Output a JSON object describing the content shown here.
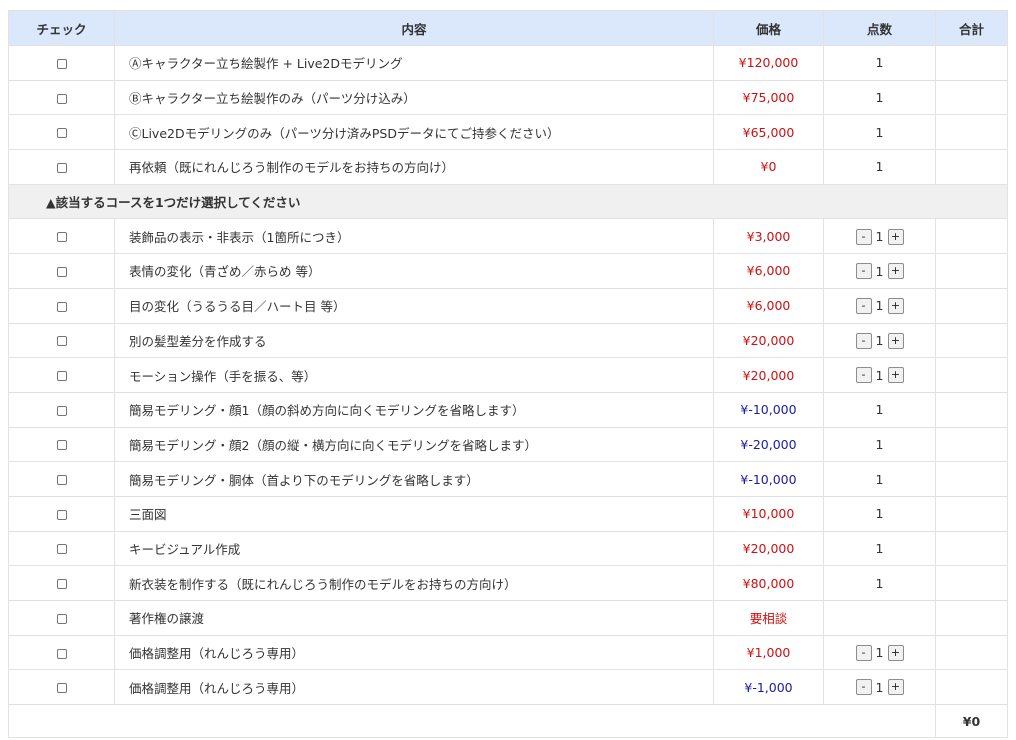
{
  "header": {
    "check": "チェック",
    "content": "内容",
    "price": "価格",
    "quantity": "点数",
    "total": "合計"
  },
  "courses": [
    {
      "label": "Ⓐキャラクター立ち絵製作 + Live2Dモデリング",
      "price": "¥120,000",
      "qty": "1"
    },
    {
      "label": "Ⓑキャラクター立ち絵製作のみ（パーツ分け込み）",
      "price": "¥75,000",
      "qty": "1"
    },
    {
      "label": "ⒸLive2Dモデリングのみ（パーツ分け済みPSDデータにてご持参ください）",
      "price": "¥65,000",
      "qty": "1"
    },
    {
      "label": "再依頼（既にれんじろう制作のモデルをお持ちの方向け）",
      "price": "¥0",
      "qty": "1"
    }
  ],
  "section_note": "▲該当するコースを1つだけ選択してください",
  "options": [
    {
      "label": "装飾品の表示・非表示（1箇所につき）",
      "price": "¥3,000",
      "qty": "1",
      "stepper": true,
      "negative": false
    },
    {
      "label": "表情の変化（青ざめ／赤らめ 等）",
      "price": "¥6,000",
      "qty": "1",
      "stepper": true,
      "negative": false
    },
    {
      "label": "目の変化（うるうる目／ハート目 等）",
      "price": "¥6,000",
      "qty": "1",
      "stepper": true,
      "negative": false
    },
    {
      "label": "別の髪型差分を作成する",
      "price": "¥20,000",
      "qty": "1",
      "stepper": true,
      "negative": false
    },
    {
      "label": "モーション操作（手を振る、等）",
      "price": "¥20,000",
      "qty": "1",
      "stepper": true,
      "negative": false
    },
    {
      "label": "簡易モデリング・顔1（顔の斜め方向に向くモデリングを省略します）",
      "price": "¥-10,000",
      "qty": "1",
      "stepper": false,
      "negative": true
    },
    {
      "label": "簡易モデリング・顔2（顔の縦・横方向に向くモデリングを省略します）",
      "price": "¥-20,000",
      "qty": "1",
      "stepper": false,
      "negative": true
    },
    {
      "label": "簡易モデリング・胴体（首より下のモデリングを省略します）",
      "price": "¥-10,000",
      "qty": "1",
      "stepper": false,
      "negative": true
    },
    {
      "label": "三面図",
      "price": "¥10,000",
      "qty": "1",
      "stepper": false,
      "negative": false
    },
    {
      "label": "キービジュアル作成",
      "price": "¥20,000",
      "qty": "1",
      "stepper": false,
      "negative": false
    },
    {
      "label": "新衣装を制作する（既にれんじろう制作のモデルをお持ちの方向け）",
      "price": "¥80,000",
      "qty": "1",
      "stepper": false,
      "negative": false
    },
    {
      "label": "著作権の譲渡",
      "price": "要相談",
      "qty": "",
      "stepper": false,
      "negative": false
    },
    {
      "label": "価格調整用（れんじろう専用）",
      "price": "¥1,000",
      "qty": "1",
      "stepper": true,
      "negative": false
    },
    {
      "label": "価格調整用（れんじろう専用）",
      "price": "¥-1,000",
      "qty": "1",
      "stepper": true,
      "negative": true
    }
  ],
  "stepper": {
    "minus": "-",
    "plus": "+"
  },
  "grand_total": "¥0",
  "colors": {
    "header_bg": "#dbe7fb",
    "positive_price": "#cc1111",
    "negative_price": "#1a1aa6",
    "section_bg": "#f0f0f0"
  }
}
